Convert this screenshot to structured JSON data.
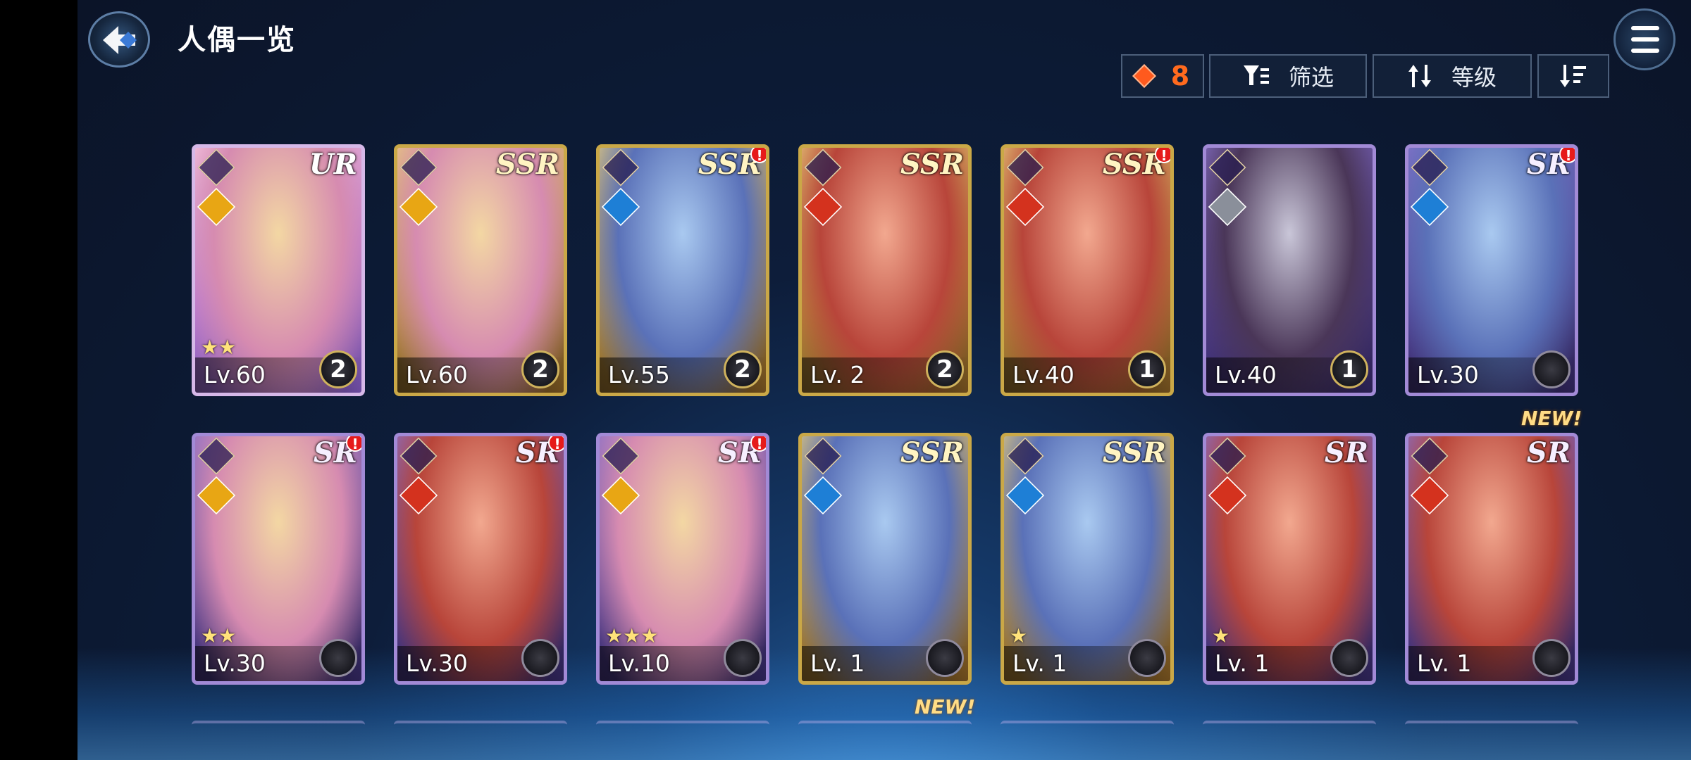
{
  "header": {
    "title": "人偶一览",
    "back_icon": "back-arrow-icon",
    "menu_icon": "hamburger-menu-icon"
  },
  "toolbar": {
    "count": "8",
    "filter_label": "筛选",
    "sort_label": "等级"
  },
  "colors": {
    "count_accent": "#ff6a1e",
    "alert": "#e61a1a",
    "new_tag": "#ffdc86"
  },
  "cards": [
    {
      "rarity": "UR",
      "level": "Lv.60",
      "rank": "2",
      "element": "light",
      "stars": "★★",
      "alert": false
    },
    {
      "rarity": "SSR",
      "level": "Lv.60",
      "rank": "2",
      "element": "light",
      "stars": "",
      "alert": false
    },
    {
      "rarity": "SSR",
      "level": "Lv.55",
      "rank": "2",
      "element": "water",
      "stars": "",
      "alert": true
    },
    {
      "rarity": "SSR",
      "level": "Lv. 2",
      "rank": "2",
      "element": "fire",
      "stars": "",
      "alert": false
    },
    {
      "rarity": "SSR",
      "level": "Lv.40",
      "rank": "1",
      "element": "fire",
      "stars": "",
      "alert": true
    },
    {
      "rarity": "",
      "level": "Lv.40",
      "rank": "1",
      "element": "dark",
      "stars": "",
      "alert": false
    },
    {
      "rarity": "SR",
      "level": "Lv.30",
      "rank": "",
      "element": "water",
      "stars": "",
      "alert": true
    },
    {
      "rarity": "SR",
      "level": "Lv.30",
      "rank": "",
      "element": "light",
      "stars": "★★",
      "alert": true
    },
    {
      "rarity": "SR",
      "level": "Lv.30",
      "rank": "",
      "element": "fire",
      "stars": "",
      "alert": true
    },
    {
      "rarity": "SR",
      "level": "Lv.10",
      "rank": "",
      "element": "light",
      "stars": "★★★",
      "alert": true
    },
    {
      "rarity": "SSR",
      "level": "Lv. 1",
      "rank": "",
      "element": "water",
      "stars": "",
      "alert": false
    },
    {
      "rarity": "SSR",
      "level": "Lv. 1",
      "rank": "",
      "element": "water",
      "stars": "★",
      "alert": false
    },
    {
      "rarity": "SR",
      "level": "Lv. 1",
      "rank": "",
      "element": "fire",
      "stars": "★",
      "alert": false
    },
    {
      "rarity": "SR",
      "level": "Lv. 1",
      "rank": "",
      "element": "fire",
      "stars": "",
      "alert": false
    }
  ],
  "new_tags": [
    "NEW!",
    "NEW!"
  ]
}
